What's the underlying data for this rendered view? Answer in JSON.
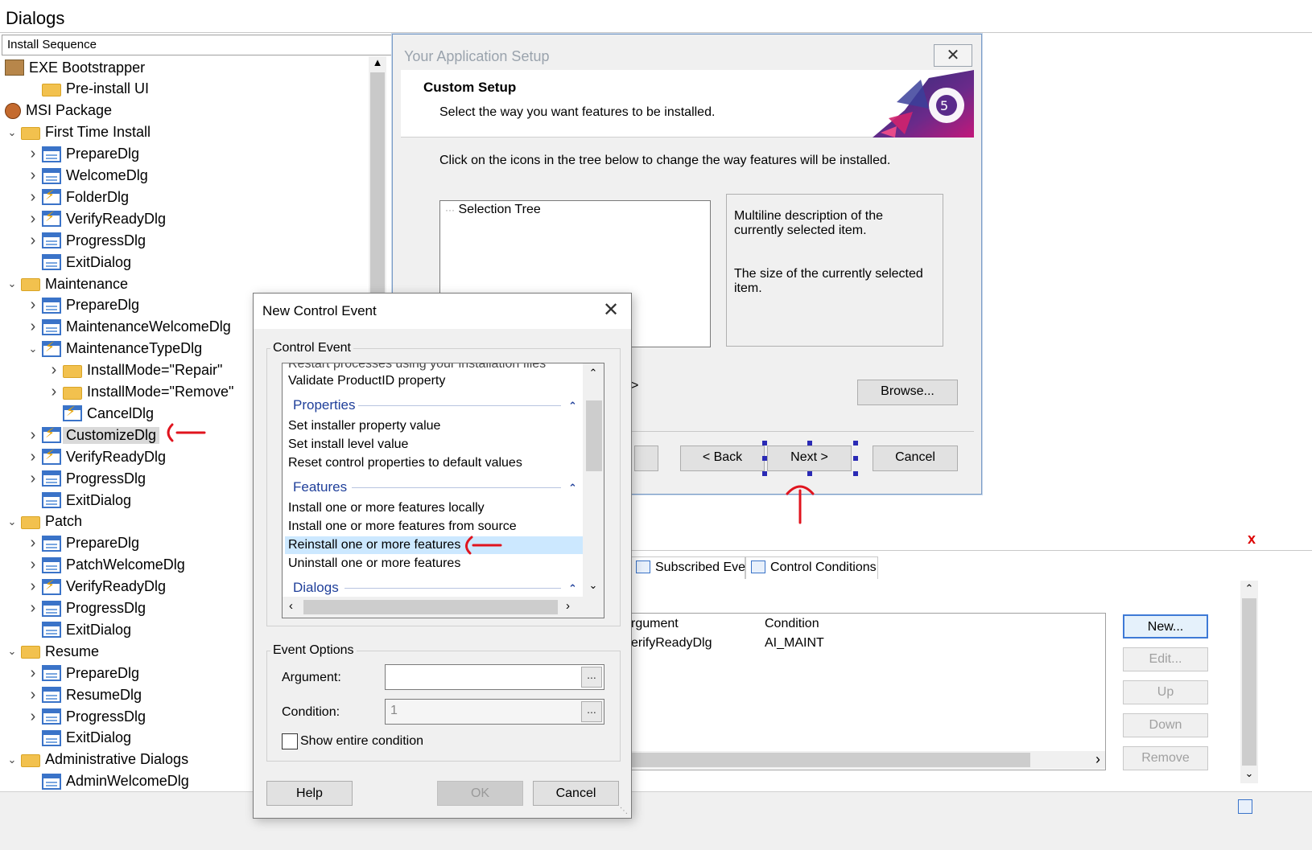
{
  "header": {
    "title": "Dialogs",
    "sequence": "Install Sequence"
  },
  "tree": [
    {
      "label": "EXE Bootstrapper",
      "icon": "package-icon",
      "indent": 0,
      "exp": ""
    },
    {
      "label": "Pre-install UI",
      "icon": "folder-icon",
      "indent": 1,
      "exp": ""
    },
    {
      "label": "MSI Package",
      "icon": "msi-package-icon",
      "indent": 0,
      "exp": ""
    },
    {
      "label": "First Time Install",
      "icon": "folder-icon",
      "indent": 0,
      "exp": "v"
    },
    {
      "label": "PrepareDlg",
      "icon": "dialog-icon",
      "indent": 1,
      "exp": ">"
    },
    {
      "label": "WelcomeDlg",
      "icon": "dialog-icon",
      "indent": 1,
      "exp": ">"
    },
    {
      "label": "FolderDlg",
      "icon": "dialog-warning-icon",
      "indent": 1,
      "exp": ">"
    },
    {
      "label": "VerifyReadyDlg",
      "icon": "dialog-warning-icon",
      "indent": 1,
      "exp": ">"
    },
    {
      "label": "ProgressDlg",
      "icon": "dialog-icon",
      "indent": 1,
      "exp": ">"
    },
    {
      "label": "ExitDialog",
      "icon": "dialog-icon",
      "indent": 1,
      "exp": ""
    },
    {
      "label": "Maintenance",
      "icon": "folder-icon",
      "indent": 0,
      "exp": "v"
    },
    {
      "label": "PrepareDlg",
      "icon": "dialog-icon",
      "indent": 1,
      "exp": ">"
    },
    {
      "label": "MaintenanceWelcomeDlg",
      "icon": "dialog-icon",
      "indent": 1,
      "exp": ">"
    },
    {
      "label": "MaintenanceTypeDlg",
      "icon": "dialog-warning-icon",
      "indent": 1,
      "exp": "v"
    },
    {
      "label": "InstallMode=\"Repair\"",
      "icon": "folder-icon",
      "indent": 2,
      "exp": ">"
    },
    {
      "label": "InstallMode=\"Remove\"",
      "icon": "folder-icon",
      "indent": 2,
      "exp": ">"
    },
    {
      "label": "CancelDlg",
      "icon": "dialog-warning-icon",
      "indent": 2,
      "exp": ""
    },
    {
      "label": "CustomizeDlg",
      "icon": "dialog-warning-icon",
      "indent": 1,
      "exp": ">",
      "selected": true
    },
    {
      "label": "VerifyReadyDlg",
      "icon": "dialog-warning-icon",
      "indent": 1,
      "exp": ">"
    },
    {
      "label": "ProgressDlg",
      "icon": "dialog-icon",
      "indent": 1,
      "exp": ">"
    },
    {
      "label": "ExitDialog",
      "icon": "dialog-icon",
      "indent": 1,
      "exp": ""
    },
    {
      "label": "Patch",
      "icon": "folder-icon",
      "indent": 0,
      "exp": "v"
    },
    {
      "label": "PrepareDlg",
      "icon": "dialog-icon",
      "indent": 1,
      "exp": ">"
    },
    {
      "label": "PatchWelcomeDlg",
      "icon": "dialog-icon",
      "indent": 1,
      "exp": ">"
    },
    {
      "label": "VerifyReadyDlg",
      "icon": "dialog-warning-icon",
      "indent": 1,
      "exp": ">"
    },
    {
      "label": "ProgressDlg",
      "icon": "dialog-icon",
      "indent": 1,
      "exp": ">"
    },
    {
      "label": "ExitDialog",
      "icon": "dialog-icon",
      "indent": 1,
      "exp": ""
    },
    {
      "label": "Resume",
      "icon": "folder-icon",
      "indent": 0,
      "exp": "v"
    },
    {
      "label": "PrepareDlg",
      "icon": "dialog-icon",
      "indent": 1,
      "exp": ">"
    },
    {
      "label": "ResumeDlg",
      "icon": "dialog-icon",
      "indent": 1,
      "exp": ">"
    },
    {
      "label": "ProgressDlg",
      "icon": "dialog-icon",
      "indent": 1,
      "exp": ">"
    },
    {
      "label": "ExitDialog",
      "icon": "dialog-icon",
      "indent": 1,
      "exp": ""
    },
    {
      "label": "Administrative Dialogs",
      "icon": "folder-icon",
      "indent": 0,
      "exp": "v"
    },
    {
      "label": "AdminWelcomeDlg",
      "icon": "dialog-icon",
      "indent": 1,
      "exp": ""
    }
  ],
  "setup": {
    "window_title": "Your Application Setup",
    "heading": "Custom Setup",
    "subtitle": "Select the way you want features to be installed.",
    "instruction": "Click on the icons in the tree below to change the way features will be installed.",
    "selection_tree": "Selection Tree",
    "desc1": "Multiline description of the currently selected item.",
    "desc2": "The size of the currently selected item.",
    "fragment": ">",
    "browse": "Browse...",
    "back": "< Back",
    "next": "Next >",
    "cancel": "Cancel"
  },
  "panel": {
    "tab_subscribed": "Subscribed Events",
    "tab_conditions": "Control Conditions",
    "col_argument": "rgument",
    "col_condition": "Condition",
    "row_argument": "erifyReadyDlg",
    "row_condition": "AI_MAINT",
    "new": "New...",
    "edit": "Edit...",
    "up": "Up",
    "down": "Down",
    "remove": "Remove",
    "close": "x"
  },
  "control_event": {
    "title": "New Control Event",
    "group_label": "Control Event",
    "list_cut": "Restart processes using your installation files",
    "list_validate": "Validate ProductID property",
    "grp_properties": "Properties",
    "p1": "Set installer property value",
    "p2": "Set install level value",
    "p3": "Reset control properties to default values",
    "grp_features": "Features",
    "f1": "Install one or more features locally",
    "f2": "Install one or more features from source",
    "f3": "Reinstall one or more features",
    "f4": "Uninstall one or more features",
    "grp_dialogs": "Dialogs",
    "options_label": "Event Options",
    "argument_label": "Argument:",
    "argument_value": "",
    "condition_label": "Condition:",
    "condition_value": "1",
    "dots": "...",
    "show_entire": "Show entire condition",
    "help": "Help",
    "ok": "OK",
    "cancel": "Cancel"
  },
  "colors": {
    "accent": "#3e7ad6",
    "annotation": "#e0141e",
    "group_text": "#1f3f9a",
    "highlight": "#cce8ff"
  }
}
